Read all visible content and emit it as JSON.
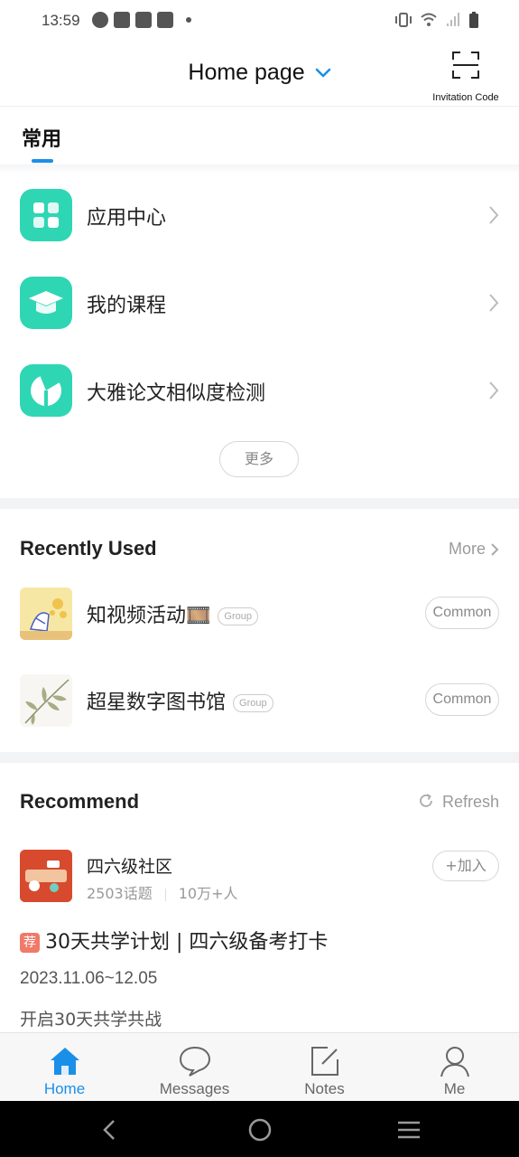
{
  "status_bar": {
    "time": "13:59"
  },
  "header": {
    "title": "Home page",
    "scan_label": "Invitation Code"
  },
  "tabs": {
    "active": "常用"
  },
  "shortcuts": [
    {
      "label": "应用中心",
      "icon": "grid-apps-icon"
    },
    {
      "label": "我的课程",
      "icon": "graduation-cap-icon"
    },
    {
      "label": "大雅论文相似度检测",
      "icon": "paper-check-icon"
    }
  ],
  "more_button": "更多",
  "recently_used": {
    "title": "Recently Used",
    "more_label": "More",
    "items": [
      {
        "title": "知视频活动🎞️",
        "tag": "Group",
        "action": "Common"
      },
      {
        "title": "超星数字图书馆",
        "tag": "Group",
        "action": "Common"
      }
    ]
  },
  "recommend": {
    "title": "Recommend",
    "refresh_label": "Refresh",
    "community": {
      "name": "四六级社区",
      "topics": "2503话题",
      "members": "10万+人",
      "join_label": "+加入"
    },
    "post": {
      "tag": "荐",
      "title": "30天共学计划 | 四六级备考打卡",
      "date": "2023.11.06~12.05",
      "desc": "开启30天共学共战"
    }
  },
  "bottom_nav": [
    {
      "label": "Home",
      "icon": "home-icon",
      "active": true
    },
    {
      "label": "Messages",
      "icon": "chat-bubble-icon",
      "active": false
    },
    {
      "label": "Notes",
      "icon": "edit-note-icon",
      "active": false
    },
    {
      "label": "Me",
      "icon": "user-icon",
      "active": false
    }
  ],
  "colors": {
    "accent": "#1a8fe8",
    "teal": "#2fd6b4",
    "tag_red": "#f07a6a"
  }
}
